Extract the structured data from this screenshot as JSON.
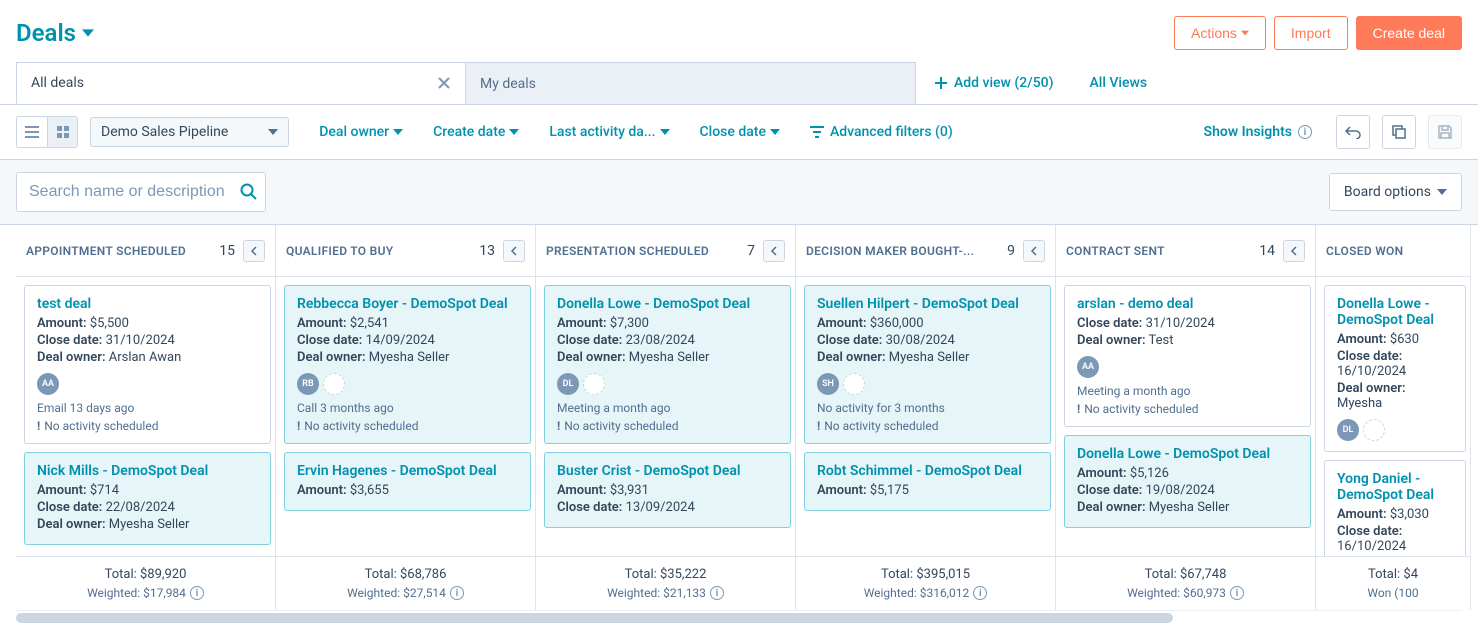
{
  "header": {
    "title": "Deals",
    "actions_label": "Actions",
    "import_label": "Import",
    "create_label": "Create deal"
  },
  "tabs": {
    "all_deals": "All deals",
    "my_deals": "My deals",
    "add_view": "Add view (2/50)",
    "all_views": "All Views"
  },
  "toolbar": {
    "pipeline": "Demo Sales Pipeline",
    "deal_owner": "Deal owner",
    "create_date": "Create date",
    "last_activity": "Last activity da...",
    "close_date": "Close date",
    "advanced_filters": "Advanced filters (0)",
    "show_insights": "Show Insights"
  },
  "search": {
    "placeholder": "Search name or description"
  },
  "board_options": "Board options",
  "labels": {
    "amount": "Amount:",
    "close_date": "Close date:",
    "deal_owner": "Deal owner:",
    "no_activity": "No activity scheduled",
    "total": "Total:",
    "weighted": "Weighted:",
    "won": "Won"
  },
  "columns": [
    {
      "title": "APPOINTMENT SCHEDULED",
      "count": "15",
      "total": "$89,920",
      "weighted": "$17,984",
      "cards": [
        {
          "title": "test deal",
          "amount": "$5,500",
          "close_date": "31/10/2024",
          "owner": "Arslan Awan",
          "avatar": "AA",
          "activity": "Email 13 days ago",
          "no_activity": true,
          "selected": false
        },
        {
          "title": "Nick Mills - DemoSpot Deal",
          "amount": "$714",
          "close_date": "22/08/2024",
          "owner": "Myesha Seller",
          "selected": true
        }
      ]
    },
    {
      "title": "QUALIFIED TO BUY",
      "count": "13",
      "total": "$68,786",
      "weighted": "$27,514",
      "cards": [
        {
          "title": "Rebbecca Boyer - DemoSpot Deal",
          "amount": "$2,541",
          "close_date": "14/09/2024",
          "owner": "Myesha Seller",
          "avatar": "RB",
          "chip": true,
          "activity": "Call 3 months ago",
          "no_activity": true,
          "selected": true
        },
        {
          "title": "Ervin Hagenes - DemoSpot Deal",
          "amount": "$3,655",
          "selected": true
        }
      ]
    },
    {
      "title": "PRESENTATION SCHEDULED",
      "count": "7",
      "total": "$35,222",
      "weighted": "$21,133",
      "cards": [
        {
          "title": "Donella Lowe - DemoSpot Deal",
          "amount": "$7,300",
          "close_date": "23/08/2024",
          "owner": "Myesha Seller",
          "avatar": "DL",
          "chip": true,
          "activity": "Meeting a month ago",
          "no_activity": true,
          "selected": true
        },
        {
          "title": "Buster Crist - DemoSpot Deal",
          "amount": "$3,931",
          "close_date": "13/09/2024",
          "selected": true
        }
      ]
    },
    {
      "title": "DECISION MAKER BOUGHT-...",
      "count": "9",
      "total": "$395,015",
      "weighted": "$316,012",
      "cards": [
        {
          "title": "Suellen Hilpert - DemoSpot Deal",
          "amount": "$360,000",
          "close_date": "30/08/2024",
          "owner": "Myesha Seller",
          "avatar": "SH",
          "chip": true,
          "activity": "No activity for 3 months",
          "no_activity": true,
          "selected": true
        },
        {
          "title": "Robt Schimmel - DemoSpot Deal",
          "amount": "$5,175",
          "selected": true
        }
      ]
    },
    {
      "title": "CONTRACT SENT",
      "count": "14",
      "total": "$67,748",
      "weighted": "$60,973",
      "cards": [
        {
          "title": "arslan - demo deal",
          "close_date": "31/10/2024",
          "owner": "Test",
          "avatar": "AA",
          "activity": "Meeting a month ago",
          "no_activity": true,
          "selected": false
        },
        {
          "title": "Donella Lowe - DemoSpot Deal",
          "amount": "$5,126",
          "close_date": "19/08/2024",
          "owner": "Myesha Seller",
          "selected": true
        }
      ]
    },
    {
      "title": "CLOSED WON",
      "count": "",
      "total": "$4",
      "won": "(100",
      "cards": [
        {
          "title": "Donella Lowe - DemoSpot Deal",
          "amount": "$630",
          "close_date": "16/10/2024",
          "owner": "Myesha",
          "avatar": "DL",
          "chip": true,
          "selected": false,
          "truncated": true
        },
        {
          "title": "Yong Daniel - DemoSpot Deal",
          "amount": "$3,030",
          "close_date": "16/10/2024",
          "selected": false,
          "truncated": true
        }
      ]
    }
  ]
}
